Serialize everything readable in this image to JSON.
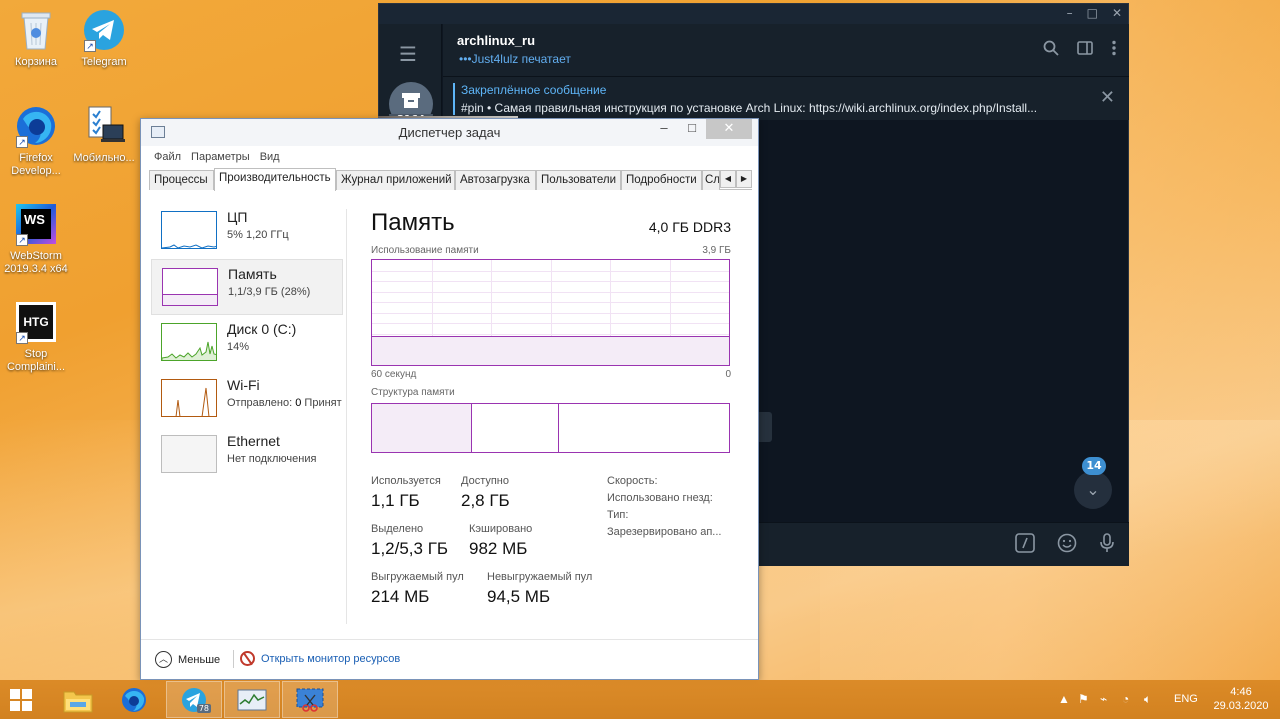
{
  "desktop": {
    "icons": [
      {
        "label": "Корзина",
        "icon": "recycle-bin-icon"
      },
      {
        "label": "Telegram",
        "icon": "telegram-icon"
      },
      {
        "label": "Firefox Develop...",
        "icon": "firefox-developer-icon"
      },
      {
        "label": "Мобильно...",
        "icon": "mobile-computer-icon"
      },
      {
        "label": "WebStorm 2019.3.4 x64",
        "icon": "webstorm-icon",
        "badge": "WS"
      },
      {
        "label": "Stop Complaini...",
        "icon": "htg-icon",
        "badge": "HTG"
      }
    ]
  },
  "telegram": {
    "controls": {
      "minimize": "–",
      "maximize": "□",
      "close": "✕"
    },
    "archive_count": "2164",
    "chat_title": "archlinux_ru",
    "typing_status": "•••Just4lulz печатает",
    "pinned": {
      "title": "Закреплённое сообщение",
      "text": "#pin • Самая правильная инструкция по установке Arch Linux: https://wiki.archlinux.org/index.php/Install..."
    },
    "unread_badge": "14",
    "accent_color": "#5eb5f7"
  },
  "taskmgr": {
    "title": "Диспетчер задач",
    "controls": {
      "minimize": "–",
      "maximize": "□",
      "close": "✕"
    },
    "menu": [
      "Файл",
      "Параметры",
      "Вид"
    ],
    "tabs": [
      "Процессы",
      "Производительность",
      "Журнал приложений",
      "Автозагрузка",
      "Пользователи",
      "Подробности",
      "Сл"
    ],
    "active_tab": "Производительность",
    "resources": [
      {
        "name": "ЦП",
        "sub": "5% 1,20 ГГц",
        "color": "#1170c4"
      },
      {
        "name": "Память",
        "sub": "1,1/3,9 ГБ (28%)",
        "color": "#9a34b1"
      },
      {
        "name": "Диск 0 (C:)",
        "sub": "14%",
        "color": "#4ca42a"
      },
      {
        "name": "Wi-Fi",
        "sub_label": "Отправлено:",
        "sub_value": "0",
        "sub_extra": "Принят",
        "color": "#b25a10"
      },
      {
        "name": "Ethernet",
        "sub": "Нет подключения",
        "color": "#9a9a9a"
      }
    ],
    "memory": {
      "title": "Память",
      "spec": "4,0 ГБ DDR3",
      "usage_label": "Использование памяти",
      "max_label": "3,9 ГБ",
      "time_left": "60 секунд",
      "time_right": "0",
      "usage_fraction": 0.28,
      "structure_label": "Структура памяти",
      "structure_fractions": [
        0.28,
        0.245,
        0.475
      ],
      "stats": [
        {
          "label": "Используется",
          "value": "1,1 ГБ"
        },
        {
          "label": "Доступно",
          "value": "2,8 ГБ"
        },
        {
          "label": "Выделено",
          "value": "1,2/5,3 ГБ"
        },
        {
          "label": "Кэшировано",
          "value": "982 МБ"
        },
        {
          "label": "Выгружаемый пул",
          "value": "214 МБ"
        },
        {
          "label": "Невыгружаемый пул",
          "value": "94,5 МБ"
        }
      ],
      "details": [
        "Скорость:",
        "Использовано гнезд:",
        "Тип:",
        "Зарезервировано ап..."
      ]
    },
    "footer": {
      "less": "Меньше",
      "monitor": "Открыть монитор ресурсов"
    }
  },
  "taskbar": {
    "apps": [
      "file-explorer-icon",
      "firefox-icon",
      "telegram-icon",
      "task-manager-icon",
      "snipping-tool-icon"
    ],
    "telegram_badge": "78",
    "language": "ENG",
    "time": "4:46",
    "date": "29.03.2020"
  }
}
